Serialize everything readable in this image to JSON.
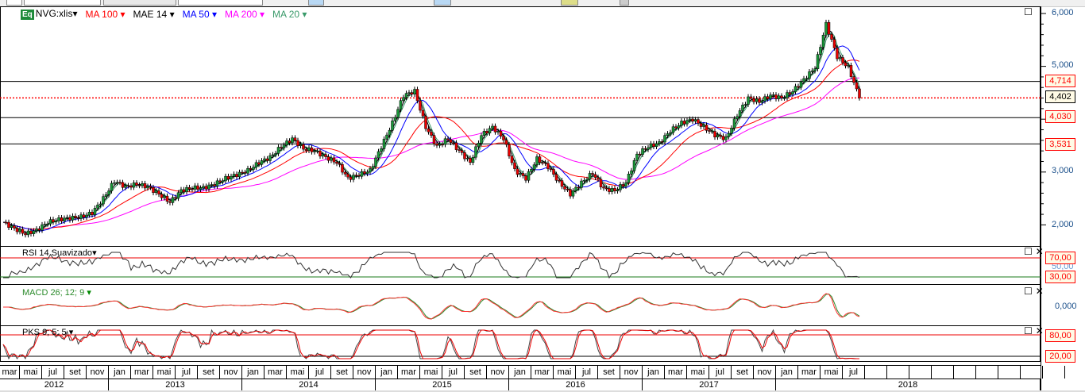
{
  "legend": [
    {
      "label": "NVG:xlis",
      "color": "#000000",
      "icon": "eq-icon",
      "badge": "Eq"
    },
    {
      "label": "MA 100",
      "color": "#ff0000"
    },
    {
      "label": "MAE 14",
      "color": "#000000"
    },
    {
      "label": "MA 50",
      "color": "#0000ff"
    },
    {
      "label": "MA 200",
      "color": "#ff00ff"
    },
    {
      "label": "MA 20",
      "color": "#3a9a6a"
    }
  ],
  "price_axis": {
    "labels": [
      "6,000",
      "5,000",
      "3,000",
      "2,000"
    ],
    "tags": {
      "line1": "4,714",
      "last": "4,402",
      "line2": "4,030",
      "line3": "3,531"
    }
  },
  "panels": {
    "rsi": {
      "label": "RSI 14 Suavizado",
      "levels": [
        "70,00",
        "30,00"
      ],
      "mid": "50,00"
    },
    "macd": {
      "label": "MACD 26; 12; 9",
      "zero": "0,000"
    },
    "pks": {
      "label": "PKS 9; 5; 5",
      "levels": [
        "80,00",
        "20,00"
      ]
    }
  },
  "time_axis": {
    "months": [
      "mar",
      "mai",
      "jul",
      "set",
      "nov",
      "jan",
      "mar",
      "mai",
      "jul",
      "set",
      "nov",
      "jan",
      "mar",
      "mai",
      "jul",
      "set",
      "nov",
      "jan",
      "mar",
      "mai",
      "jul",
      "set",
      "nov",
      "jan",
      "mar",
      "mai",
      "jul",
      "set",
      "nov",
      "jan",
      "mar",
      "mai",
      "jul",
      "set",
      "nov",
      "jan",
      "mar",
      "mai",
      "jul",
      "",
      "",
      "",
      "",
      "",
      "",
      "",
      "",
      ""
    ],
    "years": [
      "2012",
      "2013",
      "2014",
      "2015",
      "2016",
      "2017",
      "2018"
    ]
  },
  "chart_data": {
    "type": "line",
    "x_start": "2012-03",
    "x_step": "month",
    "values": [
      2050,
      1930,
      1830,
      1900,
      2050,
      2100,
      2130,
      2150,
      2230,
      2500,
      2830,
      2720,
      2770,
      2720,
      2580,
      2430,
      2650,
      2700,
      2700,
      2770,
      2880,
      2950,
      3030,
      3180,
      3280,
      3480,
      3630,
      3440,
      3400,
      3280,
      3180,
      2880,
      2950,
      3030,
      3480,
      3930,
      4450,
      4530,
      3850,
      3480,
      3630,
      3400,
      3180,
      3700,
      3850,
      3630,
      3030,
      2880,
      3250,
      3100,
      2800,
      2580,
      2800,
      2980,
      2680,
      2650,
      2800,
      3330,
      3480,
      3550,
      3780,
      3930,
      4000,
      3850,
      3700,
      3630,
      4080,
      4400,
      4330,
      4450,
      4400,
      4530,
      4750,
      4980,
      5800,
      5180,
      4980,
      4402
    ],
    "ylim": [
      1800,
      6100
    ],
    "horizontal_lines": [
      4714,
      4030,
      3531
    ],
    "last_price": 4402,
    "moving_averages": [
      "MA 100",
      "MAE 14",
      "MA 50",
      "MA 200",
      "MA 20"
    ]
  }
}
